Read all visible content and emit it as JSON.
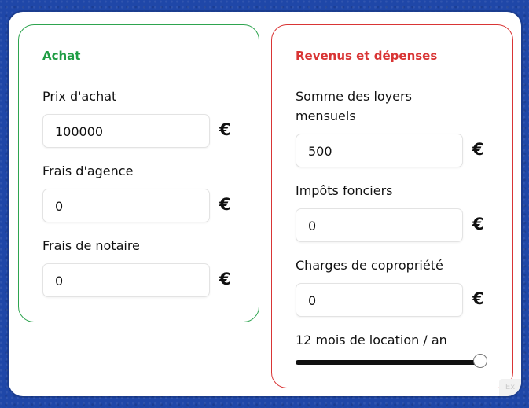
{
  "achat": {
    "title": "Achat",
    "fields": [
      {
        "label": "Prix d'achat",
        "value": "100000",
        "unit": "€"
      },
      {
        "label": "Frais d'agence",
        "value": "0",
        "unit": "€"
      },
      {
        "label": "Frais de notaire",
        "value": "0",
        "unit": "€"
      }
    ]
  },
  "revenus": {
    "title": "Revenus et dépenses",
    "fields": [
      {
        "label": "Somme des loyers mensuels",
        "value": "500",
        "unit": "€"
      },
      {
        "label": "Impôts fonciers",
        "value": "0",
        "unit": "€"
      },
      {
        "label": "Charges de copropriété",
        "value": "0",
        "unit": "€"
      }
    ],
    "location_label": "12 mois de location / an",
    "location_months": 12,
    "location_max": 12
  },
  "corner_text": "Ex"
}
